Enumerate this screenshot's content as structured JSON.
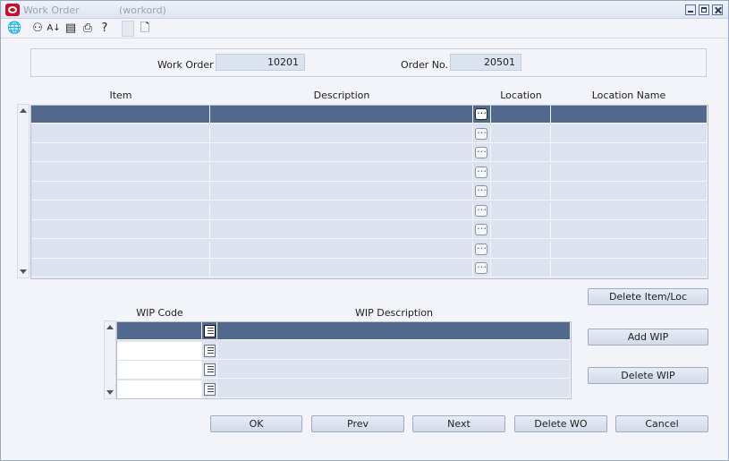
{
  "window": {
    "title": "Work Order",
    "subtitle": "(workord)"
  },
  "toolbar": {
    "icons": [
      "globe-icon",
      "help-icon",
      "spellcheck-icon",
      "notepad-icon",
      "print-icon",
      "question-icon",
      "blank-icon",
      "new-document-icon"
    ]
  },
  "header": {
    "work_order_label": "Work Order",
    "work_order_value": "10201",
    "order_no_label": "Order No.",
    "order_no_value": "20501"
  },
  "items_table": {
    "columns": [
      "Item",
      "Description",
      "Location",
      "Location Name"
    ],
    "row_count": 9,
    "selected_row": 0
  },
  "wip_table": {
    "columns": [
      "WIP Code",
      "WIP Description"
    ],
    "row_count": 4,
    "selected_row": 0
  },
  "buttons": {
    "delete_item_loc": "Delete Item/Loc",
    "add_wip": "Add WIP",
    "delete_wip": "Delete WIP",
    "ok": "OK",
    "prev": "Prev",
    "next": "Next",
    "delete_wo": "Delete WO",
    "cancel": "Cancel"
  },
  "colors": {
    "selected_row": "#52688d",
    "grid_cell": "#dce3ee",
    "field_bg": "#dbe3ef",
    "window_bg": "#f2f4f9"
  }
}
